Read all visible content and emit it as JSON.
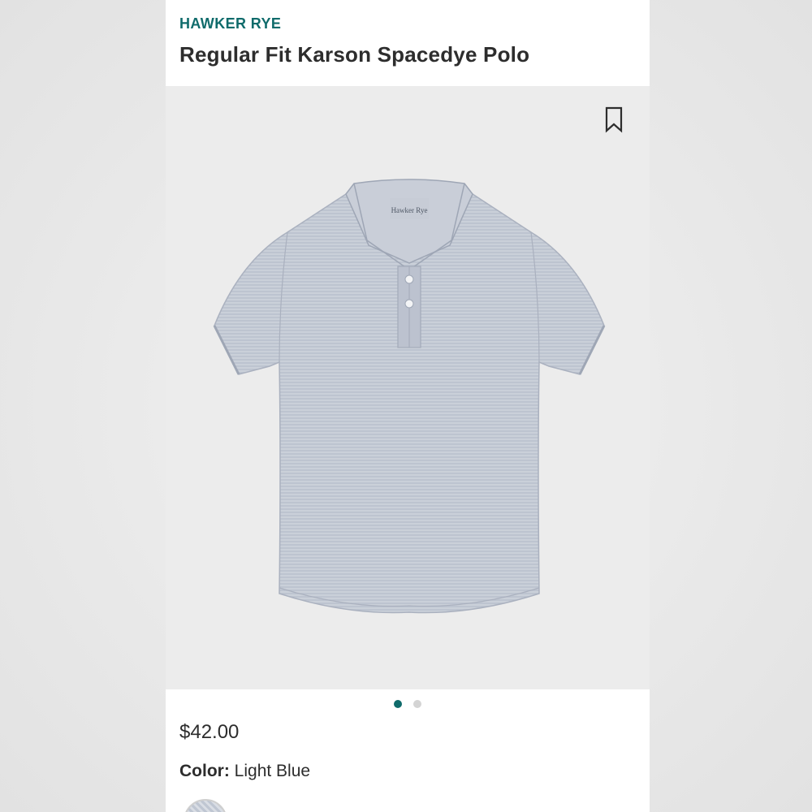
{
  "product": {
    "brand": "HAWKER RYE",
    "title": "Regular Fit Karson Spacedye Polo",
    "price": "$42.00",
    "color_label": "Color:",
    "color_value": "Light Blue",
    "tag_text": "Hawker Rye"
  },
  "gallery": {
    "slide_count": 2,
    "active_slide": 1
  },
  "icons": {
    "bookmark": "bookmark-icon"
  },
  "colors": {
    "accent": "#0f6b6b",
    "text": "#2d2d2d",
    "image_background": "#ececec",
    "shirt": "#c2c8d3"
  }
}
